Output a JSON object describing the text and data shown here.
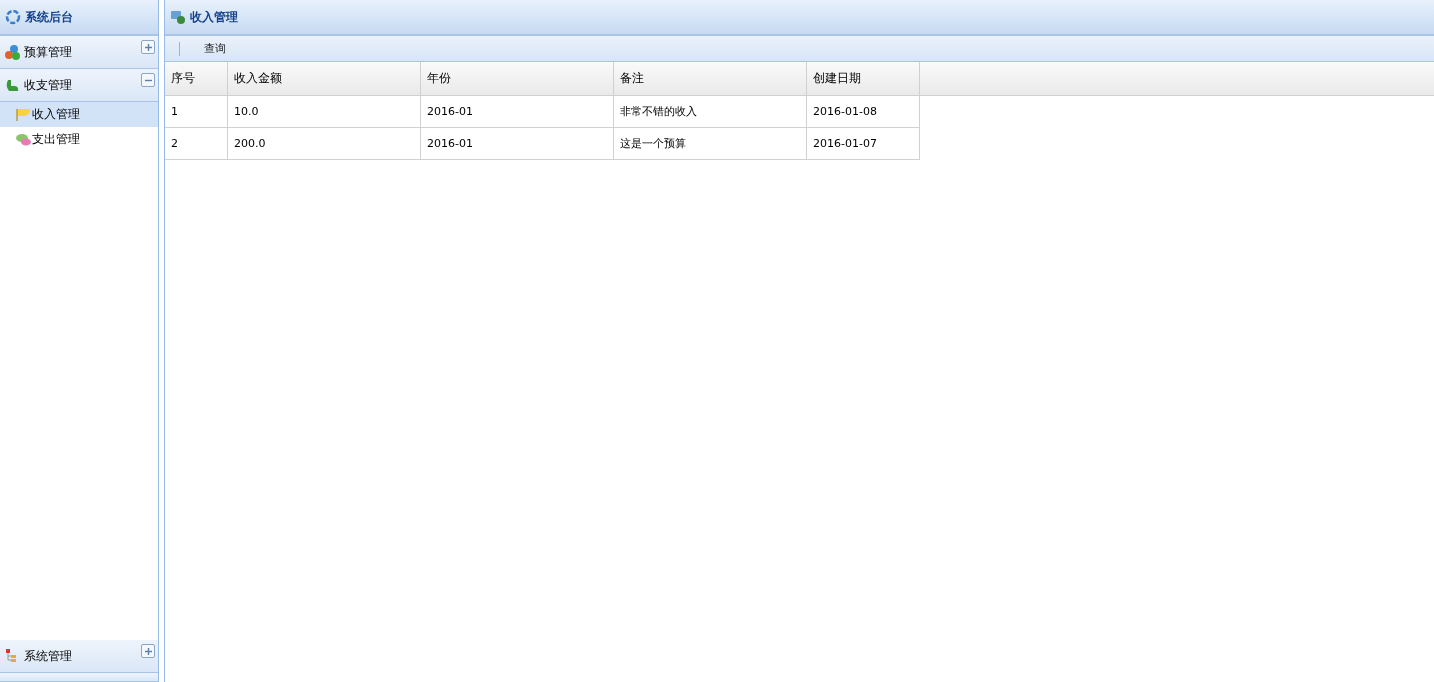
{
  "sidebar": {
    "title": "系统后台",
    "sections": [
      {
        "label": "预算管理",
        "kind": "budget",
        "expanded": false
      },
      {
        "label": "收支管理",
        "kind": "finance",
        "expanded": true,
        "items": [
          {
            "label": "收入管理",
            "kind": "income",
            "selected": true
          },
          {
            "label": "支出管理",
            "kind": "expense",
            "selected": false
          }
        ]
      },
      {
        "label": "系统管理",
        "kind": "system",
        "expanded": false
      }
    ]
  },
  "main": {
    "title": "收入管理",
    "toolbar": [
      "查询"
    ],
    "table": {
      "columns": [
        "序号",
        "收入金额",
        "年份",
        "备注",
        "创建日期"
      ],
      "rows": [
        [
          "1",
          "10.0",
          "2016-01",
          "非常不错的收入",
          "2016-01-08"
        ],
        [
          "2",
          "200.0",
          "2016-01",
          "这是一个预算",
          "2016-01-07"
        ]
      ]
    }
  }
}
